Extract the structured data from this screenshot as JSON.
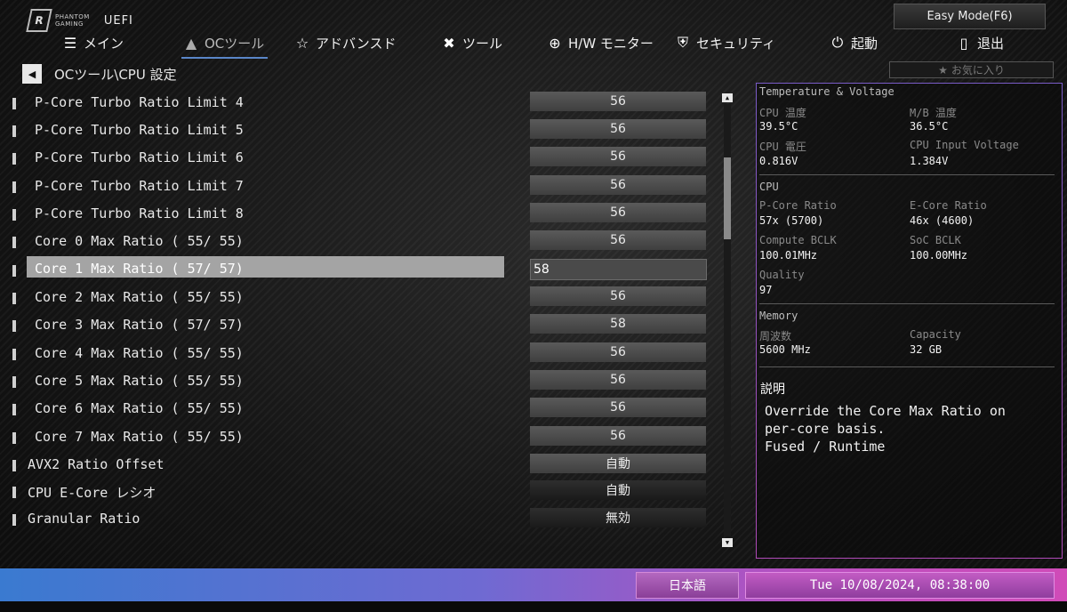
{
  "logo": {
    "brand_line1": "PHANTOM",
    "brand_line2": "GAMING",
    "mode": "UEFI"
  },
  "easy_mode_label": "Easy Mode(F6)",
  "nav": [
    {
      "label": "メイン",
      "icon": "list-icon"
    },
    {
      "label": "OCツール",
      "icon": "rocket-icon",
      "active": true
    },
    {
      "label": "アドバンスド",
      "icon": "star-icon"
    },
    {
      "label": "ツール",
      "icon": "tools-icon"
    },
    {
      "label": "H/W モニター",
      "icon": "crosshair-icon"
    },
    {
      "label": "セキュリティ",
      "icon": "shield-icon"
    },
    {
      "label": "起動",
      "icon": "power-icon"
    },
    {
      "label": "退出",
      "icon": "exit-icon"
    }
  ],
  "breadcrumb": "OCツール\\CPU 設定",
  "favorites_label": "お気に入り",
  "settings": [
    {
      "label": "P-Core Turbo Ratio Limit 4",
      "value": "56"
    },
    {
      "label": "P-Core Turbo Ratio Limit 5",
      "value": "56"
    },
    {
      "label": "P-Core Turbo Ratio Limit 6",
      "value": "56"
    },
    {
      "label": "P-Core Turbo Ratio Limit 7",
      "value": "56"
    },
    {
      "label": "P-Core Turbo Ratio Limit 8",
      "value": "56"
    },
    {
      "label": "Core 0 Max Ratio ( 55/ 55)",
      "value": "56"
    },
    {
      "label": "Core 1 Max Ratio ( 57/ 57)",
      "value": "58"
    },
    {
      "label": "Core 2 Max Ratio ( 55/ 55)",
      "value": "56"
    },
    {
      "label": "Core 3 Max Ratio ( 57/ 57)",
      "value": "58"
    },
    {
      "label": "Core 4 Max Ratio ( 55/ 55)",
      "value": "56"
    },
    {
      "label": "Core 5 Max Ratio ( 55/ 55)",
      "value": "56"
    },
    {
      "label": "Core 6 Max Ratio ( 55/ 55)",
      "value": "56"
    },
    {
      "label": "Core 7 Max Ratio ( 55/ 55)",
      "value": "56"
    },
    {
      "label": "AVX2 Ratio Offset",
      "value": "自動"
    },
    {
      "label": "CPU E-Core レシオ",
      "value": "自動"
    },
    {
      "label": "Granular Ratio",
      "value": "無効"
    }
  ],
  "monitor": {
    "section_tv": "Temperature & Voltage",
    "cpu_temp_label": "CPU 温度",
    "cpu_temp": "39.5°C",
    "mb_temp_label": "M/B 温度",
    "mb_temp": "36.5°C",
    "cpu_voltage_label": "CPU 電圧",
    "cpu_voltage": "0.816V",
    "cpu_input_voltage_label": "CPU Input Voltage",
    "cpu_input_voltage": "1.384V",
    "section_cpu": "CPU",
    "pcore_ratio_label": "P-Core Ratio",
    "pcore_ratio": "57x (5700)",
    "ecore_ratio_label": "E-Core Ratio",
    "ecore_ratio": "46x (4600)",
    "compute_bclk_label": "Compute BCLK",
    "compute_bclk": "100.01MHz",
    "soc_bclk_label": "SoC BCLK",
    "soc_bclk": "100.00MHz",
    "quality_label": "Quality",
    "quality": "97",
    "section_memory": "Memory",
    "freq_label": "周波数",
    "freq": "5600 MHz",
    "capacity_label": "Capacity",
    "capacity": "32 GB"
  },
  "description": {
    "title": "説明",
    "line1": "Override the Core Max Ratio on",
    "line2": "per-core basis.",
    "line3": "Fused / Runtime"
  },
  "footer": {
    "language": "日本語",
    "datetime": "Tue 10/08/2024, 08:38:00"
  }
}
